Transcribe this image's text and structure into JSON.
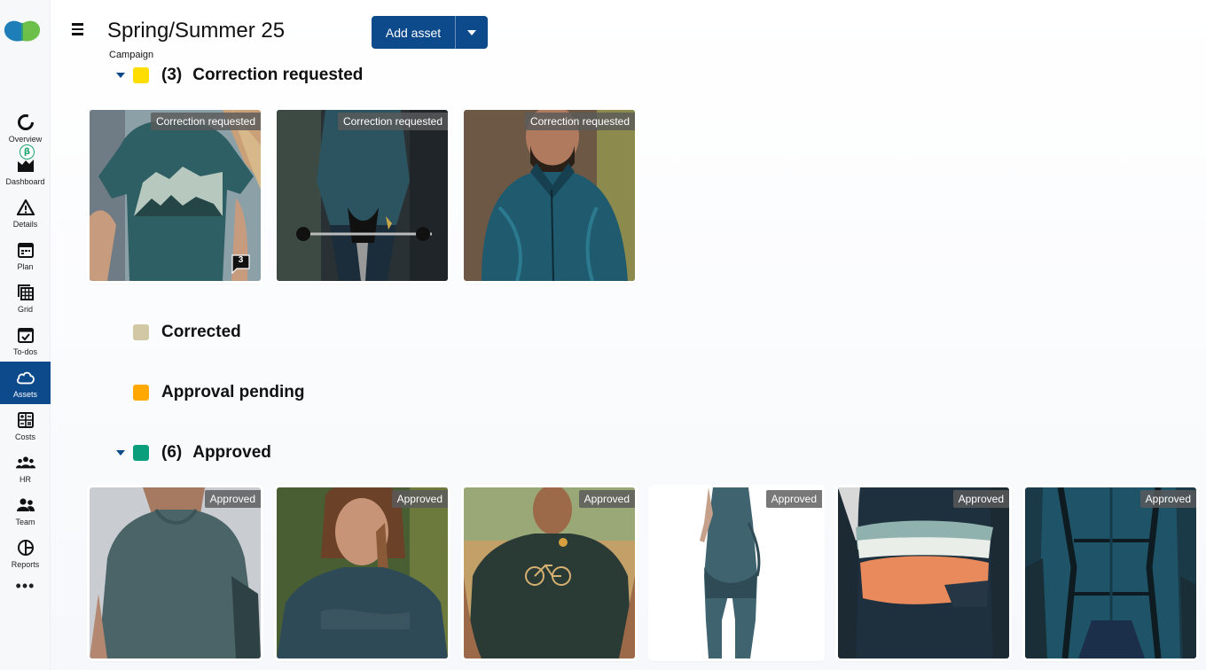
{
  "app": {
    "nav": [
      {
        "label": "Overview",
        "icon": "overview-icon"
      },
      {
        "label": "Dashboard",
        "icon": "dashboard-icon"
      },
      {
        "label": "Details",
        "icon": "details-icon"
      },
      {
        "label": "Plan",
        "icon": "calendar-icon"
      },
      {
        "label": "Grid",
        "icon": "grid-icon"
      },
      {
        "label": "To-dos",
        "icon": "todo-icon"
      },
      {
        "label": "Assets",
        "icon": "cloud-icon"
      },
      {
        "label": "Costs",
        "icon": "calculator-icon"
      },
      {
        "label": "HR",
        "icon": "people-icon"
      },
      {
        "label": "Team",
        "icon": "team-icon"
      },
      {
        "label": "Reports",
        "icon": "pie-icon"
      }
    ],
    "beta_badge": "β",
    "more": "•••"
  },
  "header": {
    "title": "Spring/Summer 25",
    "subtitle": "Campaign",
    "add_button": "Add asset"
  },
  "groups": [
    {
      "count": "(3)",
      "name": "Correction requested",
      "color": "#ffdd00",
      "expanded": true,
      "assets": [
        {
          "badge": "Correction requested",
          "comments": "3"
        },
        {
          "badge": "Correction requested"
        },
        {
          "badge": "Correction requested"
        }
      ]
    },
    {
      "name": "Corrected",
      "color": "#d2c8a6"
    },
    {
      "name": "Approval pending",
      "color": "#ffa800"
    },
    {
      "count": "(6)",
      "name": "Approved",
      "color": "#0a9e7c",
      "expanded": true,
      "assets": [
        {
          "badge": "Approved"
        },
        {
          "badge": "Approved"
        },
        {
          "badge": "Approved"
        },
        {
          "badge": "Approved"
        },
        {
          "badge": "Approved"
        },
        {
          "badge": "Approved"
        }
      ]
    }
  ],
  "colors": {
    "accent": "#0c4a8c"
  }
}
